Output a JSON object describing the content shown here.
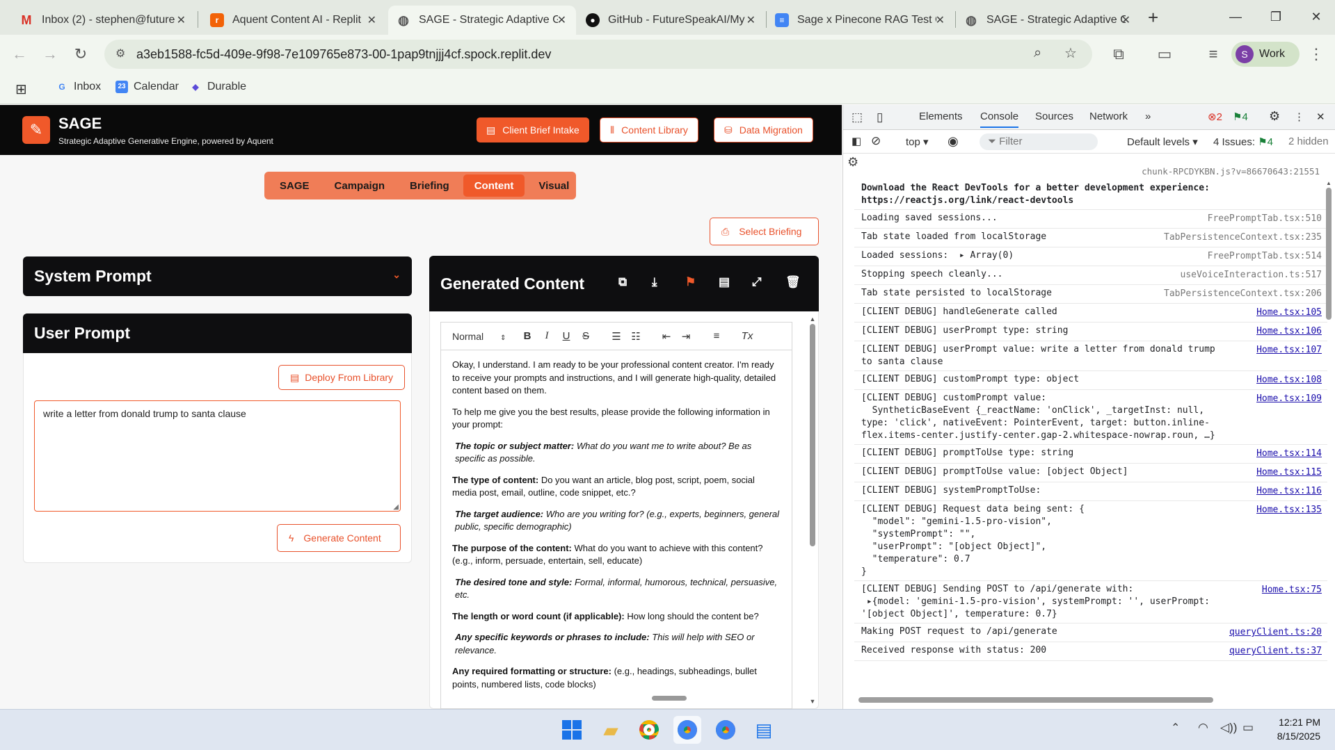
{
  "browser": {
    "tabs": [
      {
        "title": "Inbox (2) - stephen@future",
        "favicon": "gmail-icon",
        "color": "#d93025"
      },
      {
        "title": "Aquent Content AI - Replit",
        "favicon": "replit-icon",
        "color": "#f26207"
      },
      {
        "title": "SAGE - Strategic Adaptive G",
        "favicon": "globe-icon",
        "color": "#555555",
        "active": true
      },
      {
        "title": "GitHub - FutureSpeakAI/My",
        "favicon": "github-icon",
        "color": "#111111"
      },
      {
        "title": "Sage x Pinecone RAG Test C",
        "favicon": "docs-icon",
        "color": "#4285f4"
      },
      {
        "title": "SAGE - Strategic Adaptive G",
        "favicon": "globe-icon",
        "color": "#555555"
      }
    ],
    "url": "a3eb1588-fc5d-409e-9f98-7e109765e873-00-1pap9tnjjj4cf.spock.replit.dev",
    "profile": {
      "initial": "S",
      "label": "Work"
    },
    "bookmarks": [
      {
        "label": "Inbox",
        "icon": "google-icon"
      },
      {
        "label": "Calendar",
        "icon": "calendar-icon",
        "badge": "23"
      },
      {
        "label": "Durable",
        "icon": "durable-icon"
      }
    ]
  },
  "app": {
    "logo_text": "SAGE",
    "tagline": "Strategic Adaptive Generative Engine, powered by Aquent",
    "header_buttons": [
      "Client Brief Intake",
      "Content Library",
      "Data Migration"
    ],
    "nav": [
      "SAGE",
      "Campaign",
      "Briefing",
      "Content",
      "Visual"
    ],
    "nav_active": "Content",
    "select_briefing": "Select Briefing",
    "system_prompt_title": "System Prompt",
    "user_prompt_title": "User Prompt",
    "deploy_label": "Deploy From Library",
    "user_prompt_value": "write a letter from donald trump to santa clause",
    "generate_label": "Generate Content",
    "generated_title": "Generated Content",
    "editor_format": "Normal",
    "content": {
      "intro": "Okay, I understand. I am ready to be your professional content creator. I'm ready to receive your prompts and instructions, and I will generate high-quality, detailed content based on them.",
      "lead": "To help me give you the best results, please provide the following information in your prompt:",
      "items": [
        {
          "label": "The topic or subject matter:",
          "text": " What do you want me to write about? Be as specific as possible.",
          "italic": true
        },
        {
          "label": "The type of content:",
          "text": " Do you want an article, blog post, script, poem, social media post, email, outline, code snippet, etc.?",
          "italic": false
        },
        {
          "label": "The target audience:",
          "text": " Who are you writing for? (e.g., experts, beginners, general public, specific demographic)",
          "italic": true
        },
        {
          "label": "The purpose of the content:",
          "text": " What do you want to achieve with this content? (e.g., inform, persuade, entertain, sell, educate)",
          "italic": false
        },
        {
          "label": "The desired tone and style:",
          "text": " Formal, informal, humorous, technical, persuasive, etc.",
          "italic": true
        },
        {
          "label": "The length or word count (if applicable):",
          "text": " How long should the content be?",
          "italic": false
        },
        {
          "label": "Any specific keywords or phrases to include:",
          "text": " This will help with SEO or relevance.",
          "italic": true
        },
        {
          "label": "Any required formatting or structure:",
          "text": " (e.g., headings, subheadings, bullet points, numbered lists, code blocks)",
          "italic": false
        }
      ]
    }
  },
  "devtools": {
    "tabs": [
      "Elements",
      "Console",
      "Sources",
      "Network"
    ],
    "active_tab": "Console",
    "errors": "2",
    "messages": "4",
    "context": "top",
    "filter_placeholder": "Filter",
    "levels": "Default levels",
    "issues_label": "4 Issues:",
    "issues_count": "4",
    "hidden": "2 hidden",
    "top_source": "chunk-RPCDYKBN.js?v=86670643:21551",
    "logs": [
      {
        "msg": "Download the React DevTools for a better development experience: https://reactjs.org/link/react-devtools",
        "src": "",
        "bold": true
      },
      {
        "msg": "Loading saved sessions...",
        "src": "FreePromptTab.tsx:510",
        "gray": true
      },
      {
        "msg": "Tab state loaded from localStorage",
        "src": "TabPersistenceContext.tsx:235",
        "gray": true
      },
      {
        "msg": "Loaded sessions:  ▸ Array(0)",
        "src": "FreePromptTab.tsx:514",
        "gray": true
      },
      {
        "msg": "Stopping speech cleanly...",
        "src": "useVoiceInteraction.ts:517",
        "gray": true
      },
      {
        "msg": "Tab state persisted to localStorage",
        "src": "TabPersistenceContext.tsx:206",
        "gray": true
      },
      {
        "msg": "[CLIENT DEBUG] handleGenerate called",
        "src": "Home.tsx:105"
      },
      {
        "msg": "[CLIENT DEBUG] userPrompt type: string",
        "src": "Home.tsx:106"
      },
      {
        "msg": "[CLIENT DEBUG] userPrompt value: write a letter from donald trump to santa clause",
        "src": "Home.tsx:107"
      },
      {
        "msg": "[CLIENT DEBUG] customPrompt type: object",
        "src": "Home.tsx:108"
      },
      {
        "msg": "[CLIENT DEBUG] customPrompt value:\n  SyntheticBaseEvent {_reactName: 'onClick', _targetInst: null, type: 'click', nativeEvent: PointerEvent, target: button.inline-flex.items-center.justify-center.gap-2.whitespace-nowrap.roun, …}",
        "src": "Home.tsx:109"
      },
      {
        "msg": "[CLIENT DEBUG] promptToUse type: string",
        "src": "Home.tsx:114"
      },
      {
        "msg": "[CLIENT DEBUG] promptToUse value: [object Object]",
        "src": "Home.tsx:115"
      },
      {
        "msg": "[CLIENT DEBUG] systemPromptToUse:",
        "src": "Home.tsx:116"
      },
      {
        "msg": "[CLIENT DEBUG] Request data being sent: {\n  \"model\": \"gemini-1.5-pro-vision\",\n  \"systemPrompt\": \"\",\n  \"userPrompt\": \"[object Object]\",\n  \"temperature\": 0.7\n}",
        "src": "Home.tsx:135"
      },
      {
        "msg": "[CLIENT DEBUG] Sending POST to /api/generate with:\n ▸{model: 'gemini-1.5-pro-vision', systemPrompt: '', userPrompt: '[object Object]', temperature: 0.7}",
        "src": "Home.tsx:75"
      },
      {
        "msg": "Making POST request to /api/generate",
        "src": "queryClient.ts:20"
      },
      {
        "msg": "Received response with status: 200",
        "src": "queryClient.ts:37"
      }
    ]
  },
  "taskbar": {
    "time": "12:21 PM",
    "date": "8/15/2025"
  }
}
